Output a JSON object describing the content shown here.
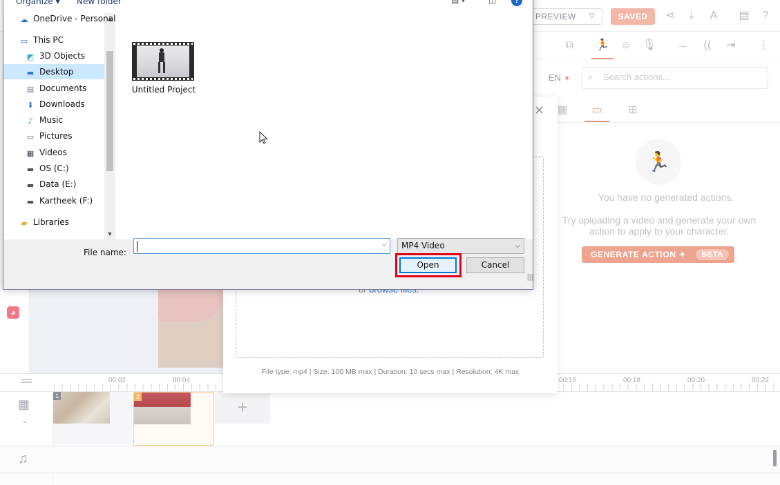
{
  "app": {
    "top": {
      "preview_label": "PREVIEW",
      "saved_label": "SAVED"
    },
    "right_panel": {
      "language": "EN",
      "search_placeholder": "Search actions...",
      "empty_title": "You have no generated actions.",
      "empty_desc": "Try uploading a video and generate your own action to apply to your character.",
      "generate_label": "GENERATE ACTION",
      "beta_label": "BETA"
    },
    "timeline": {
      "ruler_labels": [
        "00:02",
        "00:04",
        "00:16",
        "00:18",
        "00:20",
        "00:22"
      ],
      "clips": [
        {
          "number": "1"
        },
        {
          "number": "2"
        }
      ],
      "add_label": "+"
    }
  },
  "upload_modal": {
    "browse_prefix": "or",
    "browse_link": "browse files.",
    "file_info": "File type: mp4 | Size: 100 MB max | Duration: 10 secs max | Resolution: 4K max"
  },
  "file_dialog": {
    "commands": {
      "organize": "Organize ▾",
      "new_folder": "New folder"
    },
    "nav_items": [
      {
        "label": "OneDrive - Personal",
        "icon": "cloud-icon"
      },
      {
        "label": "This PC",
        "icon": "computer-icon"
      },
      {
        "label": "3D Objects",
        "icon": "cube-icon"
      },
      {
        "label": "Desktop",
        "icon": "desktop-icon",
        "selected": true
      },
      {
        "label": "Documents",
        "icon": "document-icon"
      },
      {
        "label": "Downloads",
        "icon": "download-arrow-icon"
      },
      {
        "label": "Music",
        "icon": "music-note-icon"
      },
      {
        "label": "Pictures",
        "icon": "pictures-icon"
      },
      {
        "label": "Videos",
        "icon": "video-icon"
      },
      {
        "label": "OS (C:)",
        "icon": "drive-icon"
      },
      {
        "label": "Data (E:)",
        "icon": "drive-icon"
      },
      {
        "label": "Kartheek  (F:)",
        "icon": "drive-icon"
      },
      {
        "label": "Libraries",
        "icon": "folder-icon"
      }
    ],
    "files": [
      {
        "name": "Untitled Project",
        "type": "video"
      }
    ],
    "file_name_label": "File name:",
    "file_name_value": "",
    "file_type_value": "MP4 Video",
    "open_label": "Open",
    "cancel_label": "Cancel",
    "highlight_color": "#e10016"
  }
}
